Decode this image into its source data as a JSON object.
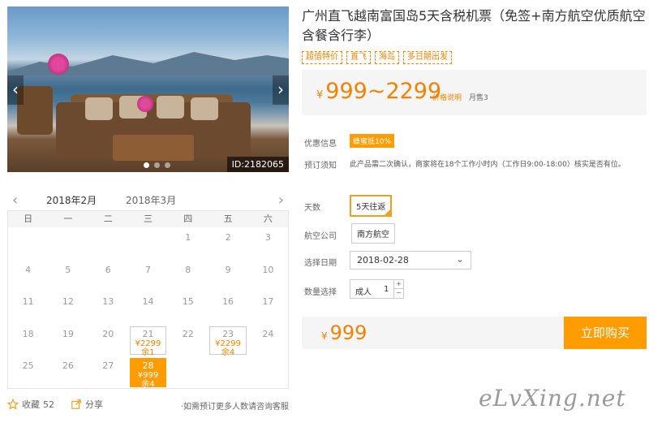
{
  "gallery": {
    "image_id": "ID:2182065",
    "slide_count": 3,
    "active_slide": 0
  },
  "calendar": {
    "months": [
      "2018年2月",
      "2018年3月"
    ],
    "active_month_index": 0,
    "weekdays": [
      "日",
      "一",
      "二",
      "三",
      "四",
      "五",
      "六"
    ],
    "leading_blanks": 4,
    "days": [
      {
        "d": "1"
      },
      {
        "d": "2"
      },
      {
        "d": "3"
      },
      {
        "d": "4"
      },
      {
        "d": "5"
      },
      {
        "d": "6"
      },
      {
        "d": "7"
      },
      {
        "d": "8"
      },
      {
        "d": "9"
      },
      {
        "d": "10"
      },
      {
        "d": "11"
      },
      {
        "d": "12"
      },
      {
        "d": "13"
      },
      {
        "d": "14"
      },
      {
        "d": "15"
      },
      {
        "d": "16"
      },
      {
        "d": "17"
      },
      {
        "d": "18"
      },
      {
        "d": "19"
      },
      {
        "d": "20"
      },
      {
        "d": "21",
        "price": "¥2299",
        "left": "余1"
      },
      {
        "d": "22"
      },
      {
        "d": "23",
        "price": "¥2299",
        "left": "余4"
      },
      {
        "d": "24"
      },
      {
        "d": "25"
      },
      {
        "d": "26"
      },
      {
        "d": "27"
      },
      {
        "d": "28",
        "price": "¥999",
        "left": "余4",
        "selected": true
      }
    ]
  },
  "footer": {
    "fav_label": "收藏",
    "fav_count": "52",
    "share_label": "分享",
    "note": "·如需预订更多人数请咨询客服"
  },
  "product": {
    "title": "广州直飞越南富国岛5天含税机票（免签+南方航空优质航空含餐含行李）",
    "tags": [
      "超值特价",
      "直飞",
      "海岛",
      "多日期出发"
    ],
    "price_range": "999~2299",
    "currency": "¥",
    "price_link": "价格说明",
    "monthly_sales": "月售3"
  },
  "info": {
    "promo_label": "优惠信息",
    "promo_badge": "蜂蜜抵10%",
    "notice_label": "预订须知",
    "notice_text": "此产品需二次确认，商家将在18个工作小时内（工作日9:00-18:00）核实是否有位。"
  },
  "options": {
    "days_label": "天数",
    "days_value": "5天往返",
    "airline_label": "航空公司",
    "airline_value": "南方航空",
    "date_label": "选择日期",
    "date_value": "2018-02-28",
    "qty_label": "数量选择",
    "qty_type": "成人",
    "qty_value": "1"
  },
  "purchase": {
    "price": "999",
    "currency": "¥",
    "buy_label": "立即购买"
  },
  "watermark": "eLvXing.net"
}
